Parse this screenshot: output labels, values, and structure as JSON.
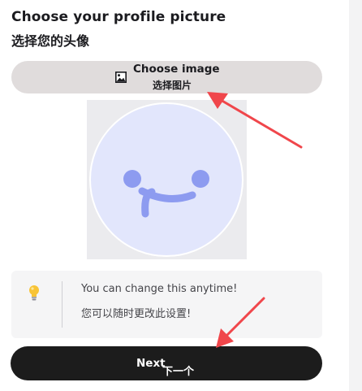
{
  "heading": {
    "title_en": "Choose your profile picture",
    "title_zh": "选择您的头像"
  },
  "choose_image": {
    "label_en": "Choose image",
    "label_zh": "选择图片",
    "icon": "image-icon"
  },
  "avatar": {
    "face_color": "#e2e6fc",
    "feature_color": "#8d9bf0"
  },
  "tip": {
    "icon": "lightbulb-icon",
    "text_en": "You can change this anytime!",
    "text_zh": "您可以随时更改此设置!"
  },
  "next_button": {
    "label_en": "Next",
    "label_zh": "下一个"
  },
  "colors": {
    "annotation_arrow": "#f0464b",
    "primary_button": "#1c1c1c",
    "secondary_button": "#e0dcdc"
  }
}
